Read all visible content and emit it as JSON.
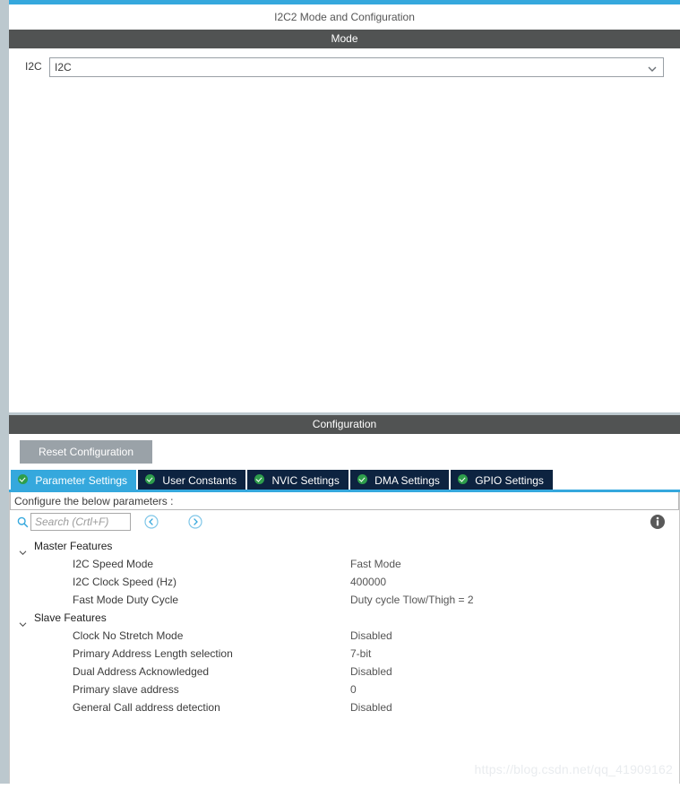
{
  "window": {
    "title": "I2C2 Mode and Configuration"
  },
  "mode_section": {
    "header": "Mode",
    "peripheral_label": "I2C",
    "peripheral_value": "I2C",
    "dropdown_icon": "chevron-down-icon"
  },
  "configuration_section": {
    "header": "Configuration",
    "reset_button": "Reset Configuration",
    "tabs": [
      {
        "label": "Parameter Settings",
        "active": true,
        "icon": "green-check-icon"
      },
      {
        "label": "User Constants",
        "active": false,
        "icon": "green-check-icon"
      },
      {
        "label": "NVIC Settings",
        "active": false,
        "icon": "green-check-icon"
      },
      {
        "label": "DMA Settings",
        "active": false,
        "icon": "green-check-icon"
      },
      {
        "label": "GPIO Settings",
        "active": false,
        "icon": "green-check-icon"
      }
    ],
    "configure_hint": "Configure the below parameters :",
    "search": {
      "placeholder": "Search (Crtl+F)",
      "value": "",
      "icon": "search-icon"
    },
    "nav_prev_icon": "chevron-left-circle-icon",
    "nav_next_icon": "chevron-right-circle-icon",
    "info_icon": "info-icon",
    "groups": [
      {
        "name": "Master Features",
        "expanded": true,
        "params": [
          {
            "name": "I2C Speed Mode",
            "value": "Fast Mode"
          },
          {
            "name": "I2C Clock Speed (Hz)",
            "value": "400000"
          },
          {
            "name": "Fast Mode Duty Cycle",
            "value": "Duty cycle Tlow/Thigh = 2"
          }
        ]
      },
      {
        "name": "Slave Features",
        "expanded": true,
        "params": [
          {
            "name": "Clock No Stretch Mode",
            "value": "Disabled"
          },
          {
            "name": "Primary Address Length selection",
            "value": "7-bit"
          },
          {
            "name": "Dual Address Acknowledged",
            "value": "Disabled"
          },
          {
            "name": "Primary slave address",
            "value": "0"
          },
          {
            "name": "General Call address detection",
            "value": "Disabled"
          }
        ]
      }
    ]
  },
  "watermark": {
    "text": "https://blog.csdn.net/qq_41909162"
  },
  "colors": {
    "accent_blue": "#35a8dd",
    "section_gray": "#515353",
    "tab_navy": "#0d2340",
    "check_green": "#2e9e4c",
    "rail_gray": "#bcc8ce",
    "button_gray": "#9aa2a8"
  }
}
